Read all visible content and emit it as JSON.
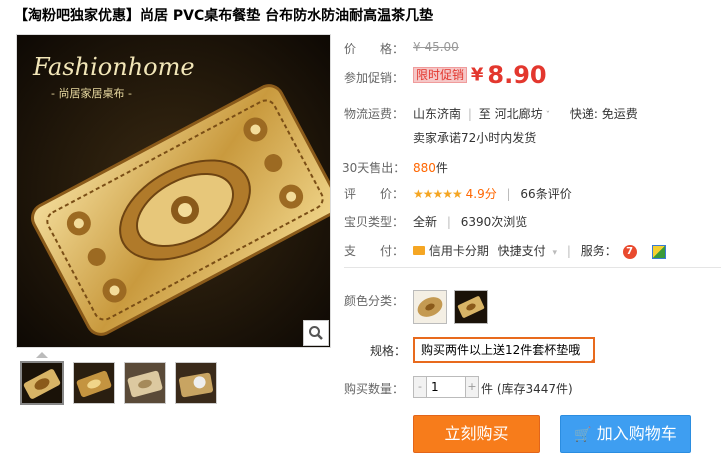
{
  "title": "【淘粉吧独家优惠】尚居 PVC桌布餐垫 台布防水防油耐高温茶几垫",
  "image": {
    "brand": "Fashionhome",
    "brand_sub": "- 尚居家居桌布 -"
  },
  "price": {
    "label": "价　　格：",
    "value": "¥ 45.00"
  },
  "promo": {
    "label": "参加促销：",
    "badge": "限时促销",
    "yen": "¥",
    "value": "8.90"
  },
  "shipping": {
    "label": "物流运费：",
    "from": "山东济南",
    "to_sep": "至",
    "to": "河北廊坊",
    "express": "快递: 免运费",
    "promise": "卖家承诺72小时内发货"
  },
  "sales": {
    "label": "30天售出：",
    "count": "880",
    "unit": "件"
  },
  "rating": {
    "label": "评　　价：",
    "stars": "★★★★★",
    "score": "4.9分",
    "reviews": "66条评价"
  },
  "item_type": {
    "label": "宝贝类型：",
    "condition": "全新",
    "views": "6390次浏览"
  },
  "payment": {
    "label": "支　　付：",
    "credit": "信用卡分期",
    "quick": "快捷支付",
    "service_label": "服务："
  },
  "color": {
    "label": "颜色分类："
  },
  "spec": {
    "label": "规格：",
    "value": "购买两件以上送12件套杯垫哦"
  },
  "quantity": {
    "label": "购买数量：",
    "minus": "-",
    "value": "1",
    "plus": "+",
    "unit_stock": "件 (库存3447件)"
  },
  "buttons": {
    "buy_now": "立刻购买",
    "add_cart": "加入购物车"
  },
  "colors": {
    "promo_red": "#e3372e",
    "buy_orange": "#f77c1b",
    "cart_blue": "#3e9ef1"
  }
}
